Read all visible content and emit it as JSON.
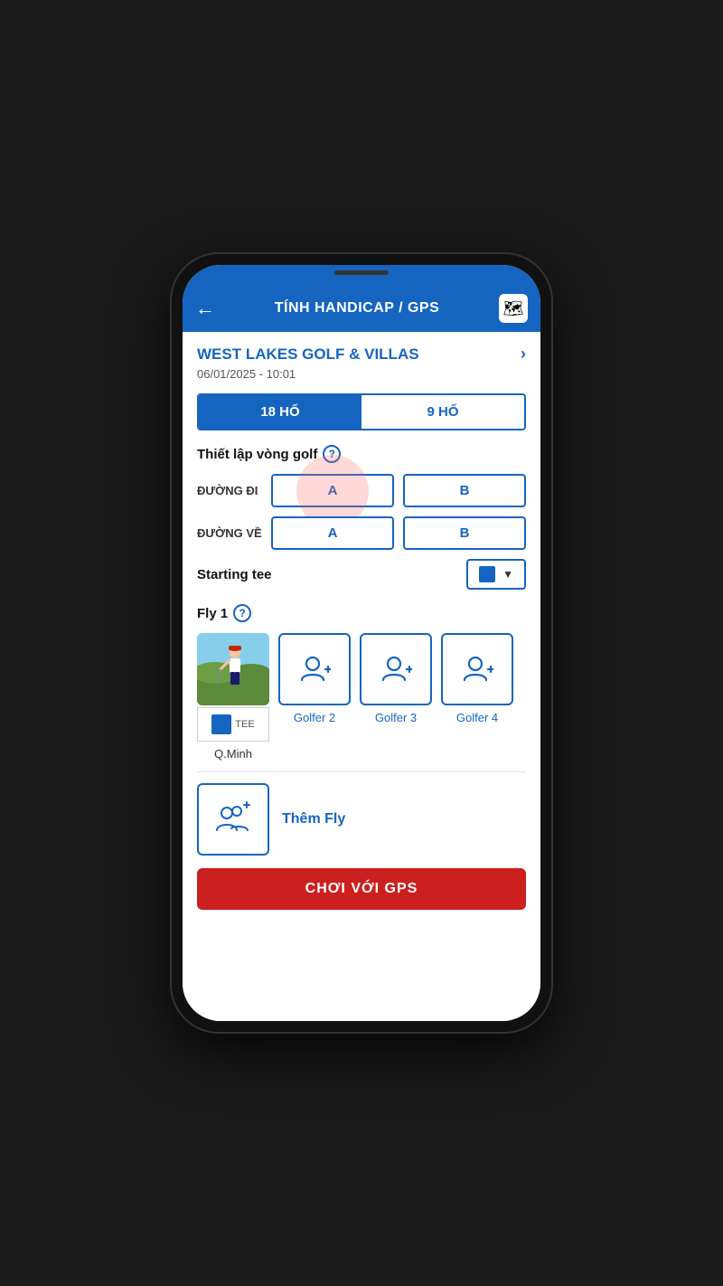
{
  "nav": {
    "back_label": "←",
    "title": "TÍNH HANDICAP / GPS",
    "map_icon": "🗺"
  },
  "course": {
    "name": "WEST LAKES GOLF & VILLAS",
    "chevron": "›",
    "date": "06/01/2025 - 10:01"
  },
  "hole_tabs": [
    {
      "label": "18 HỐ",
      "active": true
    },
    {
      "label": "9 HỐ",
      "active": false
    }
  ],
  "setup_section": {
    "label": "Thiết lập vòng golf",
    "help": "?"
  },
  "routes": [
    {
      "label": "ĐƯỜNG ĐI",
      "options": [
        "A",
        "B"
      ],
      "selected": "A"
    },
    {
      "label": "ĐƯỜNG VỀ",
      "options": [
        "A",
        "B"
      ],
      "selected": "A"
    }
  ],
  "starting_tee": {
    "label": "Starting tee",
    "color": "#1565C0",
    "arrow": "▼"
  },
  "fly1": {
    "label": "Fly 1",
    "help": "?",
    "golfers": [
      {
        "name": "Q.Minh",
        "type": "photo"
      },
      {
        "name": "Golfer 2",
        "type": "add"
      },
      {
        "name": "Golfer 3",
        "type": "add"
      },
      {
        "name": "Golfer 4",
        "type": "add"
      }
    ]
  },
  "add_fly": {
    "label": "Thêm Fly"
  },
  "play_button": {
    "label": "CHƠI VỚI GPS"
  }
}
